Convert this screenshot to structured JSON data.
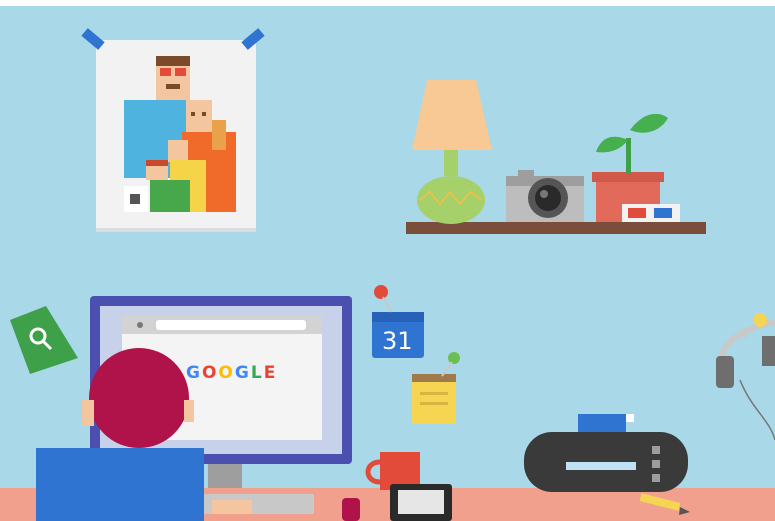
{
  "screen": {
    "logo_letters": [
      {
        "ch": "G",
        "color": "#4285f4"
      },
      {
        "ch": "O",
        "color": "#ea4335"
      },
      {
        "ch": "O",
        "color": "#fbbc05"
      },
      {
        "ch": "G",
        "color": "#4285f4"
      },
      {
        "ch": "L",
        "color": "#34a853"
      },
      {
        "ch": "E",
        "color": "#ea4335"
      }
    ]
  },
  "calendar": {
    "day": "31"
  },
  "colors": {
    "wall": "#a9d8e8",
    "desk": "#f1a08e",
    "monitor_frame": "#4a4fb0",
    "shelf": "#7a4e3a",
    "search_badge": "#3ea14a"
  },
  "icons": [
    "search-icon",
    "calendar-icon",
    "sticky-note-icon",
    "camera-icon",
    "headphones-icon",
    "printer-icon",
    "mug-icon",
    "lamp-icon",
    "plant-icon",
    "pencil-icon",
    "tablet-icon"
  ]
}
